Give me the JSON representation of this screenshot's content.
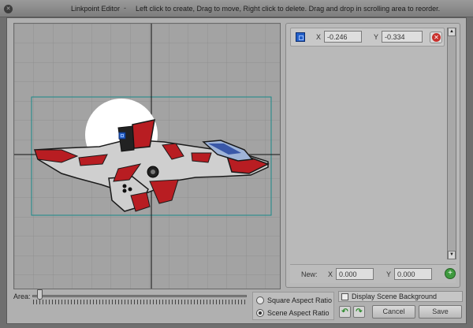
{
  "window": {
    "title": "Linkpoint Editor",
    "separator": "-",
    "instructions": "Left click to create, Drag to move, Right click to delete. Drag and drop in scrolling area to reorder."
  },
  "linkpoints": [
    {
      "x_label": "X",
      "x_value": "-0.246",
      "y_label": "Y",
      "y_value": "-0.334"
    }
  ],
  "new_point": {
    "label": "New:",
    "x_label": "X",
    "x_value": "0.000",
    "y_label": "Y",
    "y_value": "0.000"
  },
  "area": {
    "label": "Area:",
    "value": 0.02
  },
  "aspect": {
    "options": [
      "Square Aspect Ratio",
      "Scene Aspect Ratio"
    ],
    "selected": "Scene Aspect Ratio"
  },
  "display_background": {
    "label": "Display Scene Background",
    "checked": false
  },
  "buttons": {
    "cancel": "Cancel",
    "save": "Save"
  },
  "icons": {
    "close": "close-icon",
    "delete": "delete-icon",
    "add": "add-icon",
    "undo": "undo-icon",
    "redo": "redo-icon"
  },
  "colors": {
    "linkpoint": "#2460c8",
    "bounds": "#1a8a8a",
    "ship_red": "#b81d22"
  }
}
